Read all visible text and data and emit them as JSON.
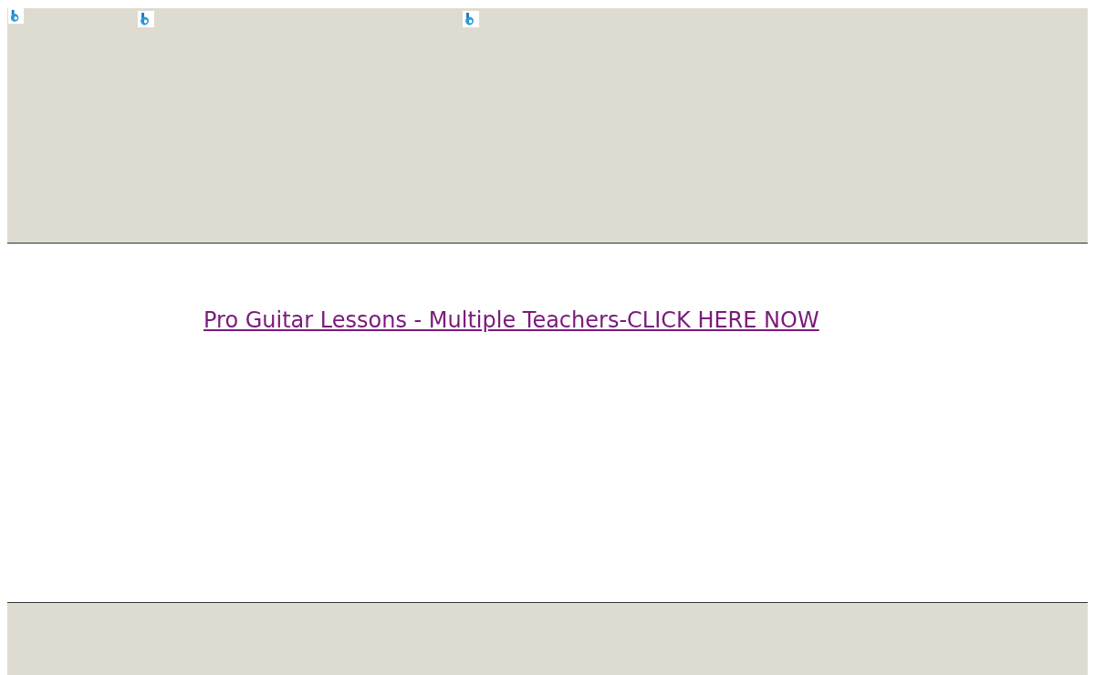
{
  "link": {
    "text": "Pro Guitar Lessons - Multiple Teachers-CLICK HERE NOW"
  }
}
